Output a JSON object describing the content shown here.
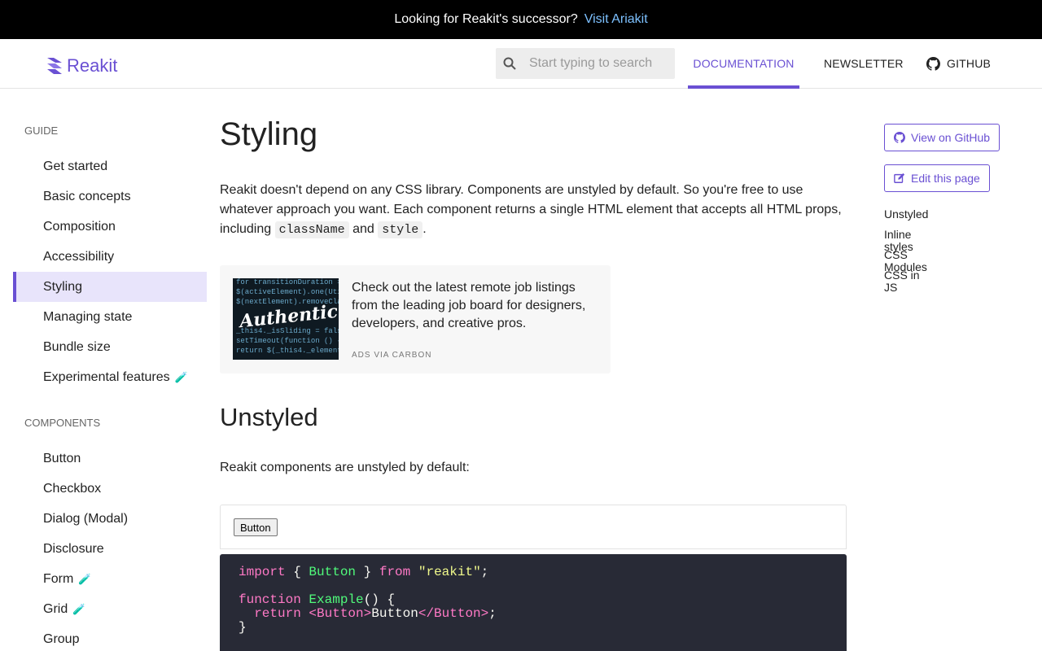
{
  "banner": {
    "text": "Looking for Reakit's successor?",
    "link": "Visit Ariakit"
  },
  "header": {
    "logo": "Reakit",
    "search_placeholder": "Start typing to search",
    "nav": {
      "documentation": "DOCUMENTATION",
      "newsletter": "NEWSLETTER",
      "github": "GITHUB"
    }
  },
  "sidebar": {
    "guide_title": "GUIDE",
    "guide_items": [
      {
        "label": "Get started"
      },
      {
        "label": "Basic concepts"
      },
      {
        "label": "Composition"
      },
      {
        "label": "Accessibility"
      },
      {
        "label": "Styling",
        "active": true
      },
      {
        "label": "Managing state"
      },
      {
        "label": "Bundle size"
      },
      {
        "label": "Experimental features",
        "flask": "🧪"
      }
    ],
    "components_title": "COMPONENTS",
    "component_items": [
      {
        "label": "Button"
      },
      {
        "label": "Checkbox"
      },
      {
        "label": "Dialog (Modal)"
      },
      {
        "label": "Disclosure"
      },
      {
        "label": "Form",
        "flask": "🧪"
      },
      {
        "label": "Grid",
        "flask": "🧪"
      },
      {
        "label": "Group"
      }
    ]
  },
  "main": {
    "title": "Styling",
    "intro": {
      "text1": "Reakit doesn't depend on any CSS library. Components are unstyled by default. So you're free to use whatever approach you want. Each component returns a single HTML element that accepts all HTML props, including ",
      "code1": "className",
      "text2": " and ",
      "code2": "style",
      "text3": "."
    },
    "carbon": {
      "brand": "Authentic",
      "text": "Check out the latest remote job listings from the leading job board for designers, developers, and creative pros.",
      "via": "ADS VIA CARBON"
    },
    "section_title": "Unstyled",
    "section_text": "Reakit components are unstyled by default:",
    "demo_button": "Button",
    "code": {
      "import_kw": "import",
      "import_brace_open": " { ",
      "import_name": "Button",
      "import_brace_close": " } ",
      "from_kw": "from",
      "module": "\"reakit\"",
      "semi": ";",
      "function_kw": "function",
      "fn_name": "Example",
      "fn_rest": "() {",
      "return_kw": "  return",
      "jsx_open": "<Button>",
      "jsx_text": "Button",
      "jsx_close": "</Button>",
      "close": "}"
    }
  },
  "rail": {
    "github_btn": "View on GitHub",
    "edit_btn": "Edit this page",
    "toc": [
      "Unstyled",
      "Inline styles",
      "CSS Modules",
      "CSS in JS"
    ]
  },
  "colors": {
    "accent": "#6a50d3",
    "banner_link": "#7dc1ff",
    "active_bg": "#e8e4fb",
    "code_bg": "#282a36"
  }
}
